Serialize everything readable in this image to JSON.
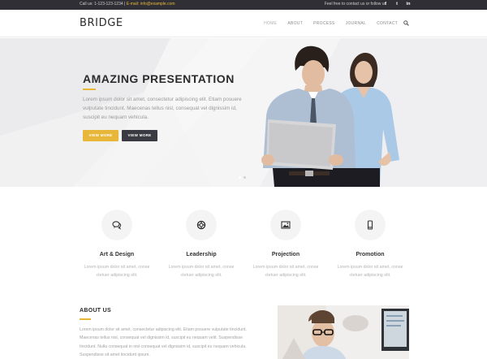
{
  "topbar": {
    "phone": "Call us: 1-123-123-1234",
    "separator": " | ",
    "email": "E-mail: info@example.com",
    "follow": "Feel free to contact us or follow us",
    "socials": [
      "f",
      "t",
      "in"
    ]
  },
  "header": {
    "logo": "BRIDGE",
    "nav": [
      "HOME",
      "ABOUT",
      "PROCESS",
      "JOURNAL",
      "CONTACT"
    ],
    "search_icon": "search-icon"
  },
  "hero": {
    "title": "AMAZING PRESENTATION",
    "text": "Lorem ipsum dolor sit amet, consectetur adipiscing elit. Etiam posuere vulputate tincidunt. Maecenas tellus nisl, consequat vel dignissim id, suscipit eu nequam vehicula.",
    "button_primary": "VIEW MORE",
    "button_secondary": "VIEW MORE"
  },
  "features": [
    {
      "icon": "chat-bubbles-icon",
      "title": "Art & Design",
      "text": "Lorem ipsum dolor sit amet, conse ctetuer adipiscing elit."
    },
    {
      "icon": "lifebuoy-icon",
      "title": "Leadership",
      "text": "Lorem ipsum dolor sit amet, conse ctetuer adipiscing elit."
    },
    {
      "icon": "image-icon",
      "title": "Projection",
      "text": "Lorem ipsum dolor sit amet, conse ctetuer adipiscing elit."
    },
    {
      "icon": "mobile-phone-icon",
      "title": "Promotion",
      "text": "Lorem ipsum dolor sit amet, conse ctetuer adipiscing elit."
    }
  ],
  "about": {
    "title": "ABOUT US",
    "text": "Lorem ipsum dolor sit amet, consectetur adipiscing elit. Etiam posuere vulputate tincidunt. Maecenas tellus nisl, consequat vel dignissim id, suscipit eu nequam velit. Suspendisse tincidunt. Nulla consequat in nisi consequat vel dignissim id, suscipit eu nequam vehicula. Suspendisse sit amet tincidunt ipsum."
  },
  "colors": {
    "accent": "#e8b73a",
    "dark": "#3a3a42",
    "topbar": "#2f2f35"
  }
}
